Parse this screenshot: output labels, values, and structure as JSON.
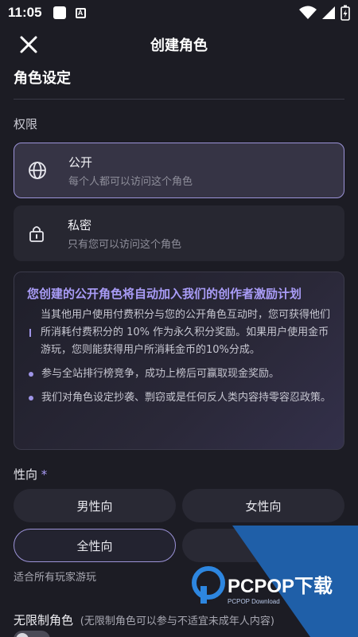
{
  "status": {
    "time": "11:05",
    "notif_icon": "A"
  },
  "topbar": {
    "title": "创建角色"
  },
  "section": {
    "title": "角色设定"
  },
  "permissions": {
    "label": "权限",
    "options": [
      {
        "title": "公开",
        "desc": "每个人都可以访问这个角色",
        "selected": true,
        "icon": "globe-icon"
      },
      {
        "title": "私密",
        "desc": "只有您可以访问这个角色",
        "selected": false,
        "icon": "lock-icon"
      }
    ]
  },
  "info": {
    "headline": "您创建的公开角色将自动加入我们的创作者激励计划",
    "items": [
      "当其他用户使用付费积分与您的公开角色互动时，您可获得他们所消耗付费积分的 10% 作为永久积分奖励。如果用户使用金币游玩，您则能获得用户所消耗金币的10%分成。",
      "参与全站排行榜竞争，成功上榜后可赢取现金奖励。",
      "我们对角色设定抄袭、剽窃或是任何反人类内容持零容忍政策。"
    ]
  },
  "orientation": {
    "label": "性向",
    "required_mark": "*",
    "options": [
      "男性向",
      "女性向",
      "全性向",
      ""
    ],
    "selected": "全性向",
    "hint": "适合所有玩家游玩"
  },
  "unlimited": {
    "label": "无限制角色",
    "note": "(无限制角色可以参与不适宜未成年人内容)",
    "enabled": false
  },
  "watermark": {
    "brand": "PCPOP下载",
    "sub": "PCPOP Download"
  },
  "colors": {
    "accent": "#9c93d8",
    "headline": "#a99cf7",
    "bg": "#1c1c24"
  }
}
